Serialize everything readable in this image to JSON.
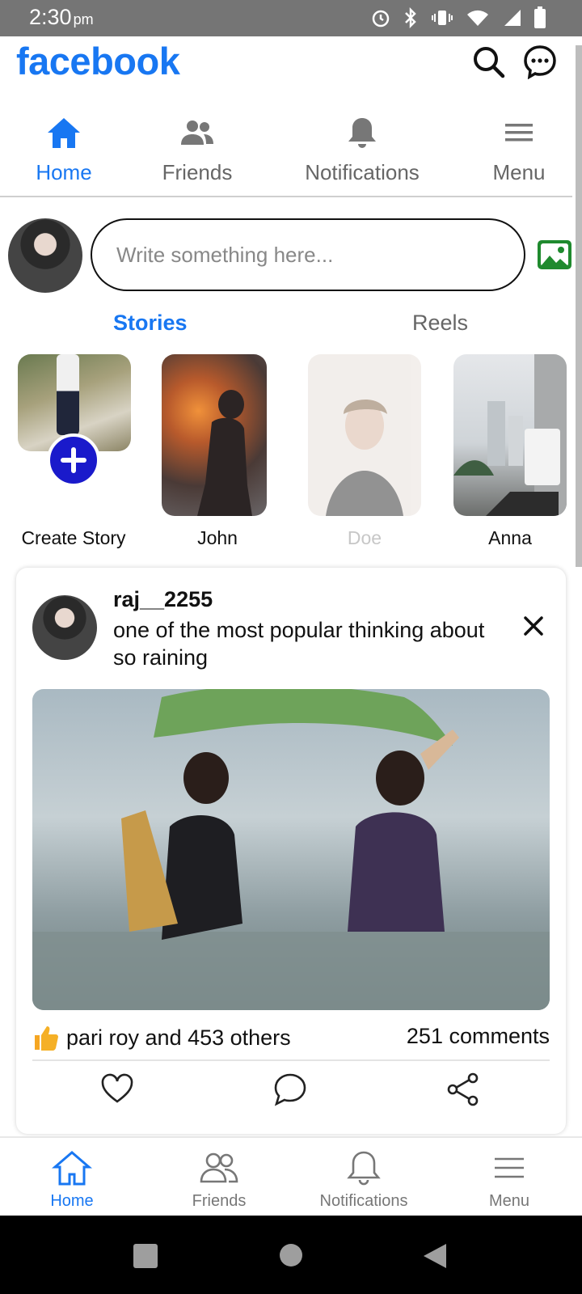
{
  "status_bar": {
    "time": "2:30",
    "period": "pm"
  },
  "header": {
    "logo": "facebook"
  },
  "top_tabs": [
    {
      "label": "Home",
      "icon": "home-icon",
      "active": true
    },
    {
      "label": "Friends",
      "icon": "friends-icon",
      "active": false
    },
    {
      "label": "Notifications",
      "icon": "bell-icon",
      "active": false
    },
    {
      "label": "Menu",
      "icon": "menu-icon",
      "active": false
    }
  ],
  "composer": {
    "placeholder": "Write something here..."
  },
  "feed_tabs": {
    "stories": "Stories",
    "reels": "Reels"
  },
  "stories": [
    {
      "name": "Create Story"
    },
    {
      "name": "John"
    },
    {
      "name": "Doe"
    },
    {
      "name": "Anna"
    }
  ],
  "post": {
    "username": "raj__2255",
    "text": "one of the most popular thinking about so raining",
    "reactions": "pari roy and 453 others",
    "comments": "251 comments"
  },
  "bottom_nav": [
    {
      "label": "Home",
      "active": true
    },
    {
      "label": "Friends",
      "active": false
    },
    {
      "label": "Notifications",
      "active": false
    },
    {
      "label": "Menu",
      "active": false
    }
  ],
  "colors": {
    "brand": "#1877f2",
    "create_story_button": "#1a1acb",
    "photo_icon": "#1f8a2e"
  }
}
